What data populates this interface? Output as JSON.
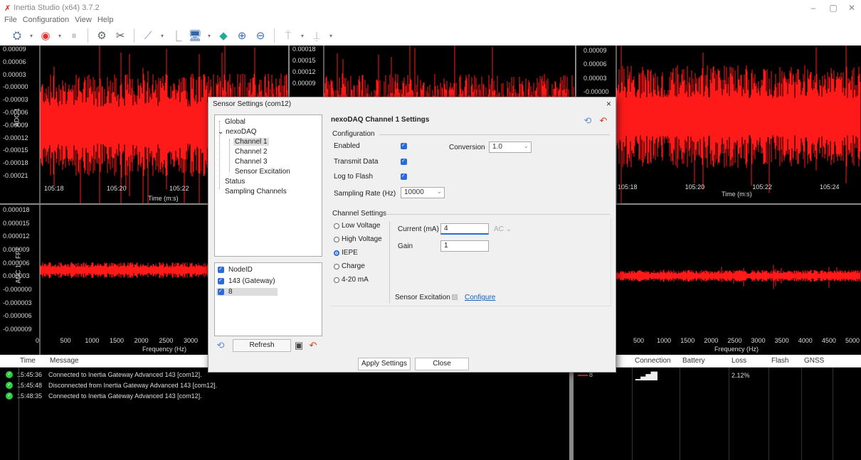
{
  "window": {
    "title": "Inertia Studio (x64) 3.7.2",
    "minimize": "–",
    "maximize": "▢",
    "close": "✕"
  },
  "menu": [
    "File",
    "Configuration",
    "View",
    "Help"
  ],
  "toolbar": {
    "icons": [
      "sensor-icon",
      "record-icon",
      "pause-icon",
      "settings-icon",
      "tools-icon",
      "chart-icon",
      "line-icon",
      "monitor-icon",
      "color-icon",
      "zoom-in-icon",
      "zoom-out-icon",
      "trigger-up-icon",
      "trigger-down-icon"
    ]
  },
  "colors": {
    "signal": "#ff1a1a",
    "background": "#000000",
    "accent": "#2b6cd4",
    "link": "#1a5fb4"
  },
  "plots": {
    "top_left": {
      "y_title": "ADC 1",
      "y_ticks": [
        "0.00009",
        "0.00006",
        "0.00003",
        "-0.00000",
        "-0.00003",
        "-0.00006",
        "-0.00009",
        "-0.00012",
        "-0.00015",
        "-0.00018",
        "-0.00021"
      ],
      "x_ticks": [
        "105:18",
        "105:20",
        "105:22"
      ],
      "x_title": "Time (m:s)"
    },
    "top_mid": {
      "y_ticks": [
        "0.00018",
        "0.00015",
        "0.00012",
        "0.00009"
      ]
    },
    "top_right": {
      "y_ticks": [
        "0.00009",
        "0.00006",
        "0.00003",
        "-0.00000"
      ],
      "x_ticks": [
        "105:18",
        "105:20",
        "105:22",
        "105:24"
      ],
      "x_title": "Time (m:s)"
    },
    "bottom_left": {
      "y_title": "ADC 1 - FFT",
      "y_ticks": [
        "0.000018",
        "0.000015",
        "0.000012",
        "0.000009",
        "0.000006",
        "0.000003",
        "-0.000000",
        "-0.000003",
        "-0.000006",
        "-0.000009"
      ],
      "x_ticks": [
        "0",
        "500",
        "1000",
        "1500",
        "2000",
        "2500",
        "3000"
      ],
      "x_title": "Frequency (Hz)"
    },
    "bottom_right": {
      "x_ticks": [
        "500",
        "1000",
        "1500",
        "2000",
        "2500",
        "3000",
        "3500",
        "4000",
        "4500",
        "5000"
      ],
      "x_title": "Frequency (Hz)"
    }
  },
  "log": {
    "headers": [
      "Time",
      "Message"
    ],
    "rows": [
      {
        "time": "15:45:36",
        "message": "Connected to Inertia Gateway Advanced 143 [com12]."
      },
      {
        "time": "15:45:48",
        "message": "Disconnected from Inertia Gateway Advanced 143 [com12]."
      },
      {
        "time": "15:48:35",
        "message": "Connected to Inertia Gateway Advanced 143 [com12]."
      }
    ]
  },
  "node_table": {
    "headers": [
      "Connection",
      "Battery",
      "Loss",
      "Flash",
      "GNSS"
    ],
    "row": {
      "node": "8",
      "loss": "2.12%"
    }
  },
  "dialog": {
    "title": "Sensor Settings (com12)",
    "close": "×",
    "tree": [
      "Global",
      "nexoDAQ",
      "Channel 1",
      "Channel 2",
      "Channel 3",
      "Sensor Excitation",
      "Status",
      "Sampling Channels"
    ],
    "nodes_header": "NodeID",
    "nodes": [
      "143 (Gateway)",
      "8"
    ],
    "refresh": "Refresh",
    "channel_title": "nexoDAQ Channel 1 Settings",
    "configuration": {
      "group": "Configuration",
      "enabled": "Enabled",
      "transmit": "Transmit Data",
      "log_flash": "Log to Flash",
      "conversion_label": "Conversion",
      "conversion_value": "1.0",
      "sampling_label": "Sampling Rate (Hz)",
      "sampling_value": "10000"
    },
    "channel_settings": {
      "group": "Channel Settings",
      "modes": [
        "Low Voltage",
        "High Voltage",
        "IEPE",
        "Charge",
        "4-20 mA"
      ],
      "selected": "IEPE",
      "current_label": "Current (mA)",
      "current_value": "4",
      "coupling": "AC",
      "gain_label": "Gain",
      "gain_value": "1",
      "excitation_label": "Sensor Excitation",
      "configure": "Configure"
    },
    "apply": "Apply Settings",
    "close_btn": "Close"
  }
}
